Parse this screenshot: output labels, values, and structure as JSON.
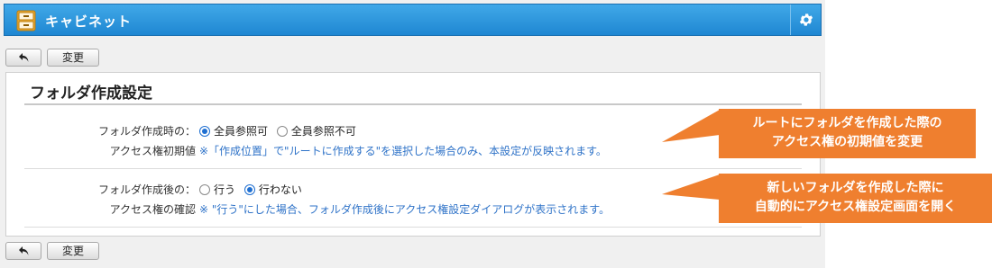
{
  "app": {
    "title": "キャビネット",
    "brand_color": "#1f87d2",
    "icons": [
      "cabinet-icon",
      "gear-icon",
      "back-arrow-icon"
    ]
  },
  "toolbar": {
    "back_icon": "back-arrow-icon",
    "change_label": "変更"
  },
  "panel": {
    "title": "フォルダ作成設定",
    "sections": [
      {
        "label_line1": "フォルダ作成時の：",
        "label_line2": "アクセス権初期値",
        "options": [
          {
            "label": "全員参照可",
            "checked": true
          },
          {
            "label": "全員参照不可",
            "checked": false
          }
        ],
        "note": "※「作成位置」で\"ルートに作成する\"を選択した場合のみ、本設定が反映されます。"
      },
      {
        "label_line1": "フォルダ作成後の：",
        "label_line2": "アクセス権の確認",
        "options": [
          {
            "label": "行う",
            "checked": false
          },
          {
            "label": "行わない",
            "checked": true
          }
        ],
        "note": "※ \"行う\"にした場合、フォルダ作成後にアクセス権設定ダイアログが表示されます。"
      }
    ]
  },
  "callouts": [
    {
      "line1": "ルートにフォルダを作成した際の",
      "line2": "アクセス権の初期値を変更",
      "color": "#ef7f2f"
    },
    {
      "line1": "新しいフォルダを作成した際に",
      "line2": "自動的にアクセス権設定画面を開く",
      "color": "#ef7f2f"
    }
  ]
}
